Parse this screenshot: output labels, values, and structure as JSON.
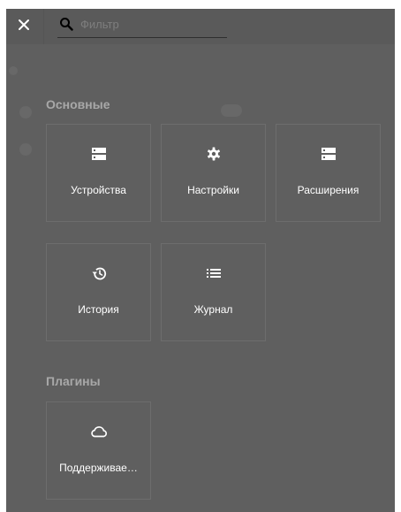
{
  "search": {
    "placeholder": "Фильтр",
    "value": ""
  },
  "sections": {
    "main": {
      "title": "Основные",
      "tiles": [
        {
          "label": "Устройства",
          "icon": "devices-icon"
        },
        {
          "label": "Настройки",
          "icon": "gear-icon"
        },
        {
          "label": "Расширения",
          "icon": "extensions-icon"
        },
        {
          "label": "История",
          "icon": "history-icon"
        },
        {
          "label": "Журнал",
          "icon": "journal-icon"
        }
      ]
    },
    "plugins": {
      "title": "Плагины",
      "tiles": [
        {
          "label": "Поддерживае…",
          "icon": "cloud-icon"
        }
      ]
    }
  },
  "colors": {
    "overlay": "#5f5f5f",
    "tile_border": "#6d6d6d",
    "section_title": "#a8a8a8",
    "text": "#ffffff"
  }
}
